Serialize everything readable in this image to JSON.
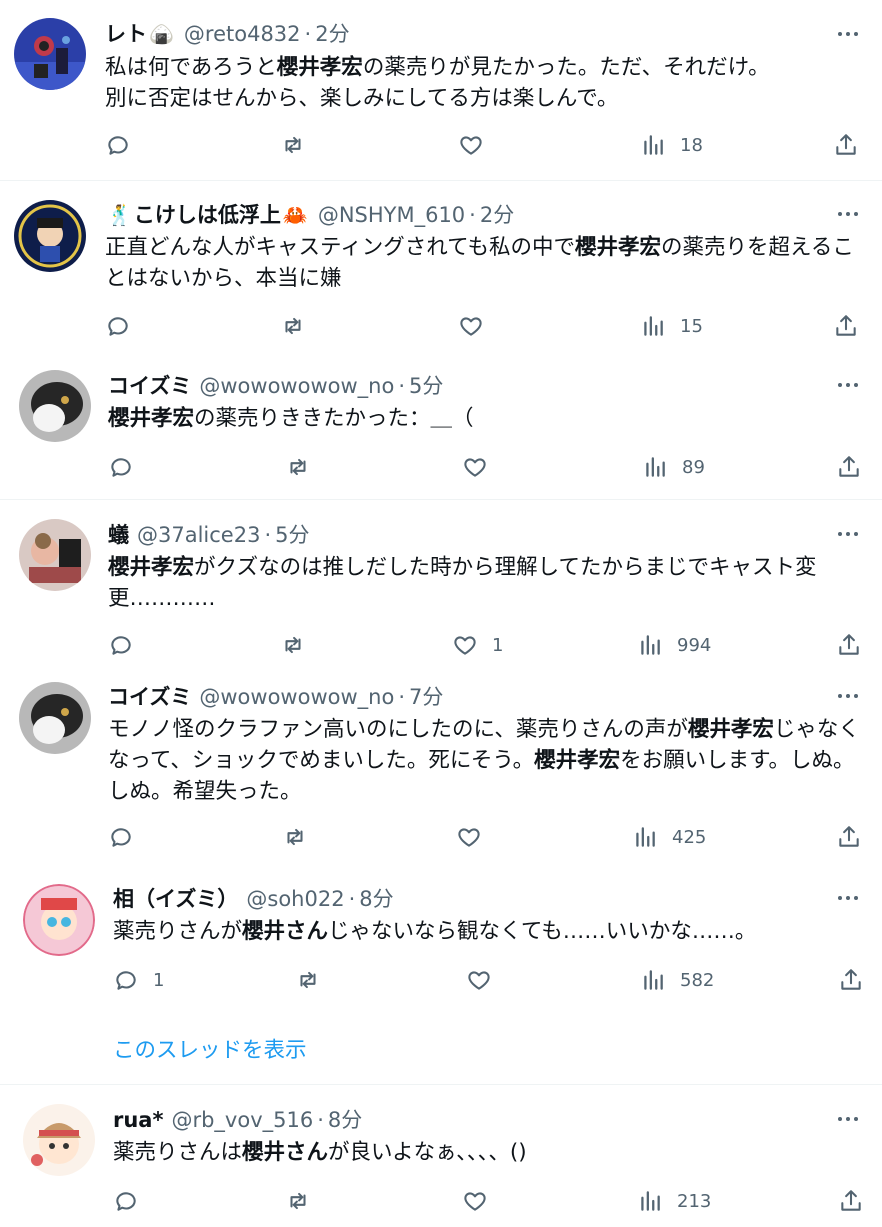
{
  "tweets": [
    {
      "name": "レト",
      "handle": "@reto4832",
      "time": "2分",
      "body": [
        {
          "t": "私は何であろうと"
        },
        {
          "t": "櫻井孝宏",
          "b": true
        },
        {
          "t": "の薬売りが見たかった。ただ、それだけ。\n別に否定はせんから、楽しみにしてる方は楽しんで。"
        }
      ],
      "reply_count": "",
      "retweet_count": "",
      "like_count": "",
      "view_count": "18"
    },
    {
      "name": "こけしは低浮上",
      "handle": "@NSHYM_610",
      "time": "2分",
      "body": [
        {
          "t": "正直どんな人がキャスティングされても私の中で"
        },
        {
          "t": "櫻井孝宏",
          "b": true
        },
        {
          "t": "の薬売りを超えることはないから、本当に嫌"
        }
      ],
      "reply_count": "",
      "retweet_count": "",
      "like_count": "",
      "view_count": "15"
    },
    {
      "name": "コイズミ",
      "handle": "@wowowowow_no",
      "time": "5分",
      "body": [
        {
          "t": "櫻井孝宏",
          "b": true
        },
        {
          "t": "の薬売りききたかった：＿（"
        }
      ],
      "reply_count": "",
      "retweet_count": "",
      "like_count": "",
      "view_count": "89"
    },
    {
      "name": "蟻",
      "handle": "@37alice23",
      "time": "5分",
      "body": [
        {
          "t": "櫻井孝宏",
          "b": true
        },
        {
          "t": "がクズなのは推しだした時から理解してたからまじでキャスト変更…………"
        }
      ],
      "reply_count": "",
      "retweet_count": "",
      "like_count": "1",
      "view_count": "994"
    },
    {
      "name": "コイズミ",
      "handle": "@wowowowow_no",
      "time": "7分",
      "body": [
        {
          "t": "モノノ怪のクラファン高いのにしたのに、薬売りさんの声が"
        },
        {
          "t": "櫻井孝宏",
          "b": true
        },
        {
          "t": "じゃなくなって、ショックでめまいした。死にそう。"
        },
        {
          "t": "櫻井孝宏",
          "b": true
        },
        {
          "t": "をお願いします。しぬ。しぬ。希望失った。"
        }
      ],
      "reply_count": "",
      "retweet_count": "",
      "like_count": "",
      "view_count": "425"
    },
    {
      "name": "相（イズミ）",
      "handle": "@soh022",
      "time": "8分",
      "body": [
        {
          "t": "薬売りさんが"
        },
        {
          "t": "櫻井さん",
          "b": true
        },
        {
          "t": "じゃないなら観なくても……いいかな……。"
        }
      ],
      "reply_count": "1",
      "retweet_count": "",
      "like_count": "",
      "view_count": "582"
    },
    {
      "name": "rua*",
      "handle": "@rb_vov_516",
      "time": "8分",
      "body": [
        {
          "t": "薬売りさんは"
        },
        {
          "t": "櫻井さん",
          "b": true
        },
        {
          "t": "が良いよなぁ、、、、()"
        }
      ],
      "reply_count": "",
      "retweet_count": "",
      "like_count": "",
      "view_count": "213"
    }
  ],
  "show_thread": "このスレッドを表示",
  "separator": "·",
  "emoji": {
    "t0": "🍙",
    "t1_pre": "🕺",
    "t1_post": "🦀"
  },
  "icons": {
    "reply": "reply-icon",
    "retweet": "retweet-icon",
    "like": "heart-icon",
    "views": "views-icon",
    "share": "share-icon",
    "more": "more-icon"
  },
  "colors": {
    "text": "#0f1419",
    "secondary": "#536471",
    "link": "#1d9bf0",
    "divider": "#eff3f4"
  }
}
